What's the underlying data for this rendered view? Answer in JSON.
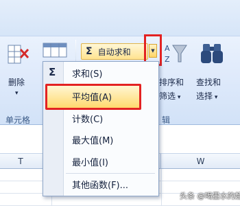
{
  "ribbon": {
    "delete_label": "删除",
    "cells_group_label": "单元格",
    "autosum_label": "自动求和",
    "sort_filter_label": "排序和",
    "sort_filter_label2": "筛选",
    "find_select_label": "查找和",
    "find_select_label2": "选择",
    "editing_group_label": "辑"
  },
  "autosum_menu": {
    "items": [
      {
        "label": "求和(S)"
      },
      {
        "label": "平均值(A)"
      },
      {
        "label": "计数(C)"
      },
      {
        "label": "最大值(M)"
      },
      {
        "label": "最小值(I)"
      },
      {
        "label": "其他函数(F)..."
      }
    ]
  },
  "sheet": {
    "col_headers": [
      "T",
      "W"
    ]
  },
  "watermark": "头条 @喝墨水的超体",
  "colors": {
    "highlight_border": "#e32222",
    "menu_hover": "#ffd96e",
    "ribbon_bg": "#dfeafb"
  },
  "icons": [
    "delete-cells-icon",
    "sigma-icon",
    "dropdown-arrow-icon",
    "sort-filter-icon",
    "binoculars-icon"
  ]
}
